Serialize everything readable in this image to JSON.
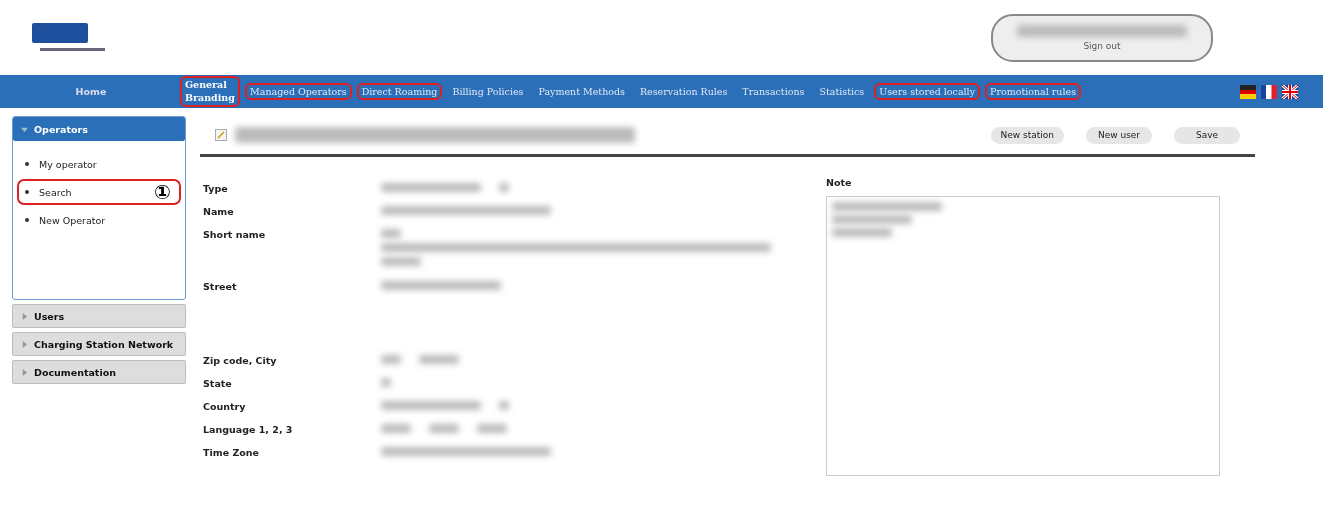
{
  "header": {
    "account": {
      "redacted": true,
      "sign_out": "Sign out"
    }
  },
  "nav": {
    "home": "Home",
    "items": [
      {
        "label": "General Branding",
        "selected": true,
        "highlighted": true
      },
      {
        "label": "Managed Operators",
        "selected": false,
        "highlighted": true
      },
      {
        "label": "Direct Roaming",
        "selected": false,
        "highlighted": true
      },
      {
        "label": "Billing Policies",
        "selected": false,
        "highlighted": false
      },
      {
        "label": "Payment Methods",
        "selected": false,
        "highlighted": false
      },
      {
        "label": "Reservation Rules",
        "selected": false,
        "highlighted": false
      },
      {
        "label": "Transactions",
        "selected": false,
        "highlighted": false
      },
      {
        "label": "Statistics",
        "selected": false,
        "highlighted": false
      },
      {
        "label": "Users stored locally",
        "selected": false,
        "highlighted": true
      },
      {
        "label": "Promotional rules",
        "selected": false,
        "highlighted": true
      }
    ],
    "languages": [
      {
        "kind": "de"
      },
      {
        "kind": "fr"
      },
      {
        "kind": "gb"
      }
    ]
  },
  "sidebar": {
    "panels": [
      {
        "title": "Operators",
        "expanded": true,
        "items": [
          {
            "label": "My operator",
            "highlighted": false
          },
          {
            "label": "Search",
            "highlighted": true,
            "callout": "①"
          },
          {
            "label": "New Operator",
            "highlighted": false
          }
        ]
      },
      {
        "title": "Users",
        "expanded": false
      },
      {
        "title": "Charging Station Network",
        "expanded": false
      },
      {
        "title": "Documentation",
        "expanded": false
      }
    ]
  },
  "main": {
    "title": {
      "redacted": true
    },
    "buttons": [
      "New station",
      "New user",
      "Save"
    ],
    "fields": [
      {
        "label": "Type",
        "kind": "select"
      },
      {
        "label": "Name",
        "kind": "text"
      },
      {
        "label": "Short name",
        "kind": "multiline"
      },
      {
        "label": "Street",
        "kind": "address"
      },
      {
        "label": "Zip code, City",
        "kind": "pair"
      },
      {
        "label": "State",
        "kind": "short"
      },
      {
        "label": "Country",
        "kind": "select"
      },
      {
        "label": "Language 1, 2, 3",
        "kind": "triple"
      },
      {
        "label": "Time Zone",
        "kind": "text"
      }
    ],
    "note": {
      "label": "Note",
      "redacted": true
    }
  }
}
